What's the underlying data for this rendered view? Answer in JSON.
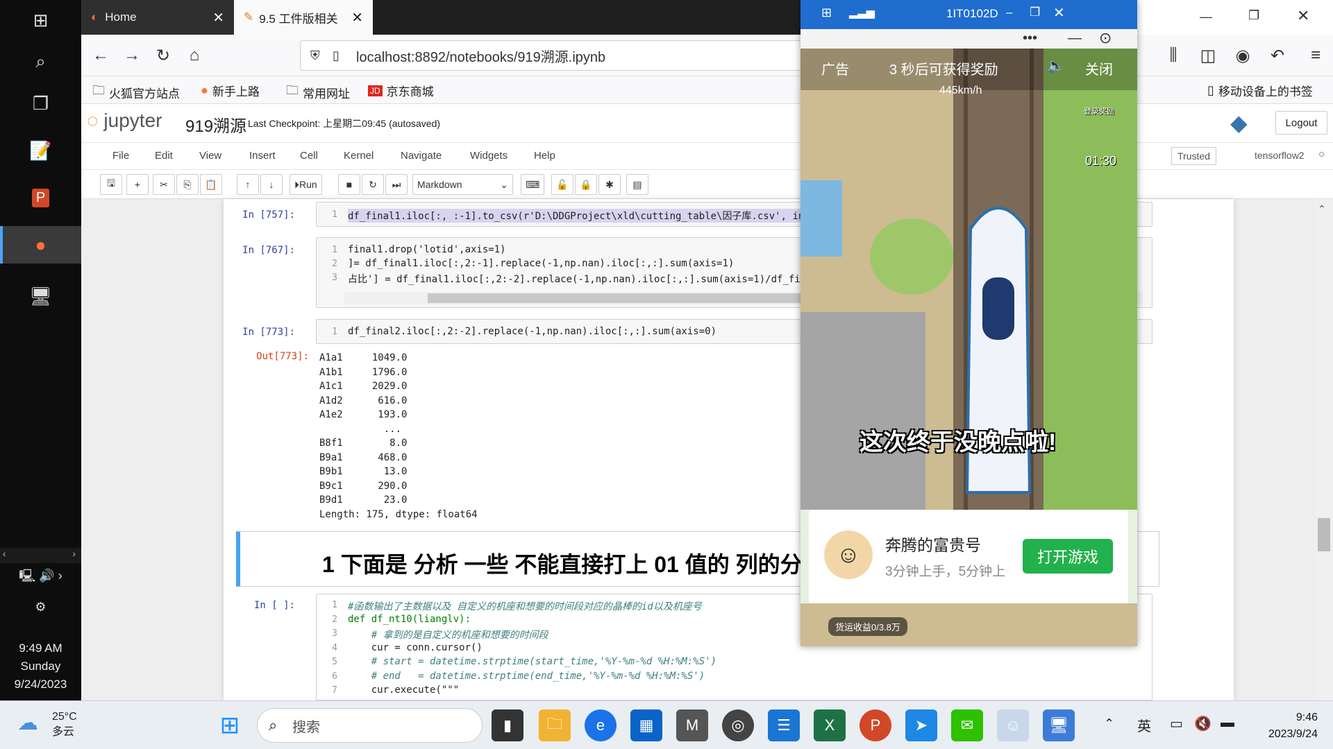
{
  "leftrail": {
    "clock_time": "9:49 AM",
    "clock_day": "Sunday",
    "clock_date": "9/24/2023"
  },
  "browser": {
    "tabs": [
      {
        "label": "Home"
      },
      {
        "label": "9.5 工件版相关"
      }
    ],
    "url": "localhost:8892/notebooks/919溯源.ipynb",
    "bookmarks": [
      "火狐官方站点",
      "新手上路",
      "常用网址",
      "京东商城"
    ],
    "mobile_bookmarks": "移动设备上的书签"
  },
  "jupyter": {
    "logo": "jupyter",
    "title": "919溯源",
    "checkpoint": "Last Checkpoint: 上星期二09:45  (autosaved)",
    "logout": "Logout",
    "trusted": "Trusted",
    "kernel": "tensorflow2",
    "menu": [
      "File",
      "Edit",
      "View",
      "Insert",
      "Cell",
      "Kernel",
      "Navigate",
      "Widgets",
      "Help"
    ],
    "run_label": "Run",
    "cell_type": "Markdown"
  },
  "cells": {
    "c757_prompt": "In [757]:",
    "c757_code": "df_final1.iloc[:, :-1].to_csv(r'D:\\DDGProject\\xld\\cutting_table\\因子库.csv', ind",
    "c767_prompt": "In [767]:",
    "c767_l1": "final1.drop('lotid',axis=1)",
    "c767_l2": "]= df_final1.iloc[:,2:-1].replace(-1,np.nan).iloc[:,:].sum(axis=1)",
    "c767_l3": "占比'] = df_final1.iloc[:,2:-2].replace(-1,np.nan).iloc[:,:].sum(axis=1)/df_fi",
    "c773_prompt": "In [773]:",
    "c773_code": "df_final2.iloc[:,2:-2].replace(-1,np.nan).iloc[:,:].sum(axis=0)",
    "out_prompt": "Out[773]:",
    "out_lines": [
      "A1a1     1049.0",
      "A1b1     1796.0",
      "A1c1     2029.0",
      "A1d2      616.0",
      "A1e2      193.0",
      "           ...",
      "B8f1        8.0",
      "B9a1      468.0",
      "B9b1       13.0",
      "B9c1      290.0",
      "B9d1       23.0",
      "Length: 175, dtype: float64"
    ],
    "md_heading": "1  下面是 分析 一些 不能直接打上 01 值的 列的分析",
    "cin_prompt": "In [ ]:",
    "cin_lines": [
      "#函数输出了主数据以及 自定义的机座和想要的时间段对应的晶棒的id以及机座号",
      "def df_nt10(lianglv):",
      "    # 拿到的是自定义的机座和想要的时间段",
      "    cur = conn.cursor()",
      "    # start = datetime.strptime(start_time,'%Y-%m-%d %H:%M:%S')",
      "    # end   = datetime.strptime(end_time,'%Y-%m-%d %H:%M:%S')",
      "    cur.execute(\"\"\""
    ]
  },
  "overlay": {
    "window_title": "1IT0102D",
    "ad_label": "广告",
    "ad_countdown": "3 秒后可获得奖励",
    "close": "关闭",
    "speed": "445km/h",
    "timer": "01:30",
    "caption": "这次终于没晚点啦!",
    "login_reward": "登录奖励",
    "game_name": "奔腾的富贵号",
    "game_desc": "3分钟上手，5分钟上",
    "open_game": "打开游戏",
    "freight": "货运收益0/3.8万"
  },
  "taskbar": {
    "weather_temp": "25°C",
    "weather_desc": "多云",
    "search_placeholder": "搜索",
    "ime": "英",
    "time": "9:46",
    "date": "2023/9/24"
  }
}
